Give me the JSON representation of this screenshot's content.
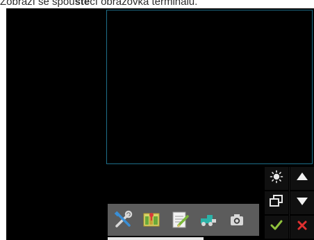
{
  "caption": {
    "prefix": "Zobrazí se spou",
    "bold": "šte",
    "suffix": "cí obrazovka terminálu."
  },
  "icons": {
    "brightness": "brightness-icon",
    "up": "arrow-up-icon",
    "window": "window-switch-icon",
    "down": "arrow-down-icon",
    "confirm": "checkmark-icon",
    "cancel": "close-icon",
    "tools": "tools-icon",
    "map": "field-map-icon",
    "notes": "notepad-icon",
    "vehicle": "vehicle-icon",
    "camera": "camera-icon"
  },
  "colors": {
    "background": "#000000",
    "frame_border": "#1e6f8a",
    "toolbar": "#5c5c5c",
    "confirm": "#8fc23c",
    "cancel": "#e03030"
  }
}
